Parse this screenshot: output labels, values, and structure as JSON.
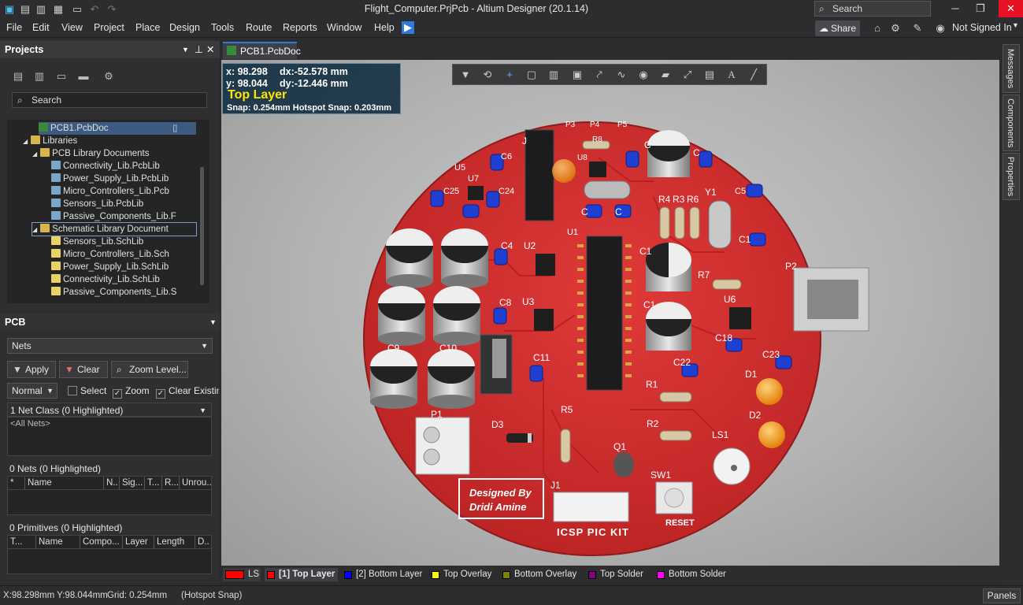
{
  "window": {
    "title": "Flight_Computer.PrjPcb - Altium Designer (20.1.14)",
    "search_placeholder": "Search"
  },
  "menu": [
    "File",
    "Edit",
    "View",
    "Project",
    "Place",
    "Design",
    "Tools",
    "Route",
    "Reports",
    "Window",
    "Help"
  ],
  "topright": {
    "share": "Share",
    "user": "Not Signed In"
  },
  "projects_panel": {
    "title": "Projects",
    "search_placeholder": "Search",
    "tree": [
      {
        "label": "PCB1.PcbDoc",
        "level": 3,
        "selected": true
      },
      {
        "label": "Libraries",
        "level": 1
      },
      {
        "label": "PCB Library Documents",
        "level": 2
      },
      {
        "label": "Connectivity_Lib.PcbLib",
        "level": 3
      },
      {
        "label": "Power_Supply_Lib.PcbLib",
        "level": 3
      },
      {
        "label": "Micro_Controllers_Lib.Pcb",
        "level": 3
      },
      {
        "label": "Sensors_Lib.PcbLib",
        "level": 3
      },
      {
        "label": "Passive_Components_Lib.F",
        "level": 3
      },
      {
        "label": "Schematic Library Document",
        "level": 2,
        "outlined": true
      },
      {
        "label": "Sensors_Lib.SchLib",
        "level": 3
      },
      {
        "label": "Micro_Controllers_Lib.Sch",
        "level": 3
      },
      {
        "label": "Power_Supply_Lib.SchLib",
        "level": 3
      },
      {
        "label": "Connectivity_Lib.SchLib",
        "level": 3
      },
      {
        "label": "Passive_Components_Lib.S",
        "level": 3
      }
    ]
  },
  "pcb_panel": {
    "title": "PCB",
    "dropdown": "Nets",
    "apply": "Apply",
    "clear": "Clear",
    "zoom_level": "Zoom Level...",
    "mode": "Normal",
    "chk_select": "Select",
    "chk_zoom": "Zoom",
    "chk_clear": "Clear Existin",
    "net_class_header": "1 Net Class (0 Highlighted)",
    "net_class_item": "<All Nets>",
    "nets_header": "0 Nets (0 Highlighted)",
    "nets_cols": [
      "Name",
      "N..",
      "Sig...",
      "T...",
      "R...",
      "Unrou..."
    ],
    "prims_header": "0 Primitives (0 Highlighted)",
    "prims_cols": [
      "T...",
      "Name",
      "Compo...",
      "Layer",
      "Length",
      "D.."
    ]
  },
  "doc_tab": "PCB1.PcbDoc",
  "hud": {
    "x": "x: 98.298",
    "dx": "dx:-52.578 mm",
    "y": "y: 98.044",
    "dy": "dy:-12.446  mm",
    "layer": "Top Layer",
    "snap": "Snap: 0.254mm Hotspot Snap: 0.203mm"
  },
  "right_tabs": [
    "Messages",
    "Components",
    "Properties"
  ],
  "layers": [
    {
      "label": "LS",
      "color": "#ff0000"
    },
    {
      "label": "[1] Top Layer",
      "color": "#ff0000",
      "active": true
    },
    {
      "label": "[2] Bottom Layer",
      "color": "#0000ff"
    },
    {
      "label": "Top Overlay",
      "color": "#ffff00"
    },
    {
      "label": "Bottom Overlay",
      "color": "#808000"
    },
    {
      "label": "Top Solder",
      "color": "#800080"
    },
    {
      "label": "Bottom Solder",
      "color": "#ff00ff"
    }
  ],
  "status": {
    "coords": "X:98.298mm Y:98.044mm",
    "grid": "Grid: 0.254mm",
    "snap": "(Hotspot Snap)",
    "panels": "Panels"
  },
  "board": {
    "designer_line1": "Designed By",
    "designer_line2": "Dridi Amine",
    "connector_label": "ICSP PIC KIT",
    "reset": "RESET",
    "refs": [
      "P3",
      "P4",
      "P5",
      "J",
      "U8",
      "R8",
      "C",
      "C",
      "U5",
      "U7",
      "C6",
      "C25",
      "C24",
      "C5",
      "C",
      "C",
      "R4",
      "R3",
      "R6",
      "Y1",
      "C1",
      "U1",
      "C4",
      "U2",
      "C1",
      "R7",
      "P2",
      "U6",
      "C8",
      "U3",
      "C1",
      "C18",
      "C23",
      "C22",
      "C11",
      "C9",
      "C10",
      "D1",
      "R1",
      "D2",
      "P1",
      "R5",
      "D3",
      "R2",
      "LS1",
      "Q1",
      "SW1",
      "J1"
    ]
  },
  "colors": {
    "board": "#d12b2b",
    "accent": "#2f7bd8"
  }
}
